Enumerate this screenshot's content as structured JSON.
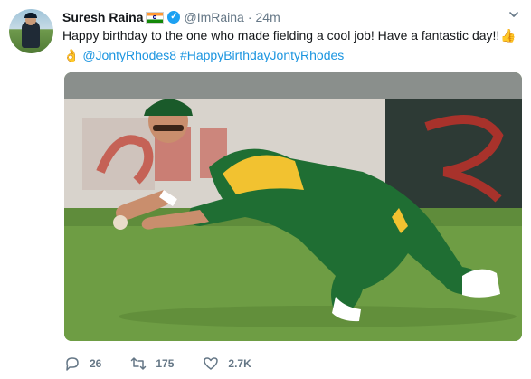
{
  "tweet": {
    "author": {
      "name": "Suresh Raina",
      "flag_icon": "india-flag-icon",
      "verified_icon": "verified-badge-icon",
      "handle": "@ImRaina",
      "separator": "·",
      "time": "24m"
    },
    "text": {
      "line1": "Happy birthday to the one who made fielding a cool job! Have a fantastic day!!",
      "emoji_thumbs": "👍",
      "emoji_ok": "👌",
      "mention": "@JontyRhodes8",
      "hashtag": "#HappyBirthdayJontyRhodes"
    },
    "media": {
      "description_icon": "photo-fielder-diving"
    },
    "actions": {
      "reply_count": "26",
      "retweet_count": "175",
      "like_count": "2.7K"
    },
    "colors": {
      "link": "#1b95e0",
      "muted": "#657786",
      "verified": "#1da1f2"
    }
  }
}
